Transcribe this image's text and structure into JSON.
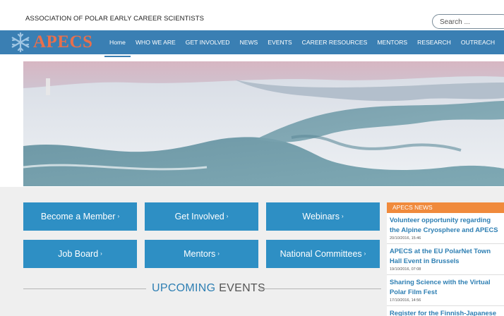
{
  "header": {
    "org_name": "ASSOCIATION OF POLAR EARLY CAREER SCIENTISTS",
    "search_placeholder": "Search ..."
  },
  "logo": {
    "text": "APECS"
  },
  "nav": {
    "items": [
      "Home",
      "WHO WE ARE",
      "GET INVOLVED",
      "NEWS",
      "EVENTS",
      "CAREER RESOURCES",
      "MENTORS",
      "RESEARCH",
      "OUTREACH"
    ],
    "active": "Home"
  },
  "tiles": [
    "Become a Member",
    "Get Involved",
    "Webinars",
    "Job Board",
    "Mentors",
    "National Committees"
  ],
  "upcoming": {
    "strong": "UPCOMING",
    "rest": " EVENTS"
  },
  "news": {
    "header": "APECS NEWS",
    "items": [
      {
        "title": "Volunteer opportunity regarding the Alpine Cryosphere and APECS",
        "date": "20/10/2016, 15:46"
      },
      {
        "title": "APECS at the EU PolarNet Town Hall Event in Brussels",
        "date": "19/10/2016, 07:08"
      },
      {
        "title": "Sharing Science with the Virtual Polar Film Fest",
        "date": "17/10/2016, 14:56"
      },
      {
        "title": "Register for the Finnish-Japanese",
        "date": ""
      }
    ]
  },
  "colors": {
    "nav_bg": "#3a7fb3",
    "tile_bg": "#2e8fc4",
    "logo": "#e86f4c",
    "news_header": "#f08a3c",
    "link": "#2e7fb3"
  }
}
